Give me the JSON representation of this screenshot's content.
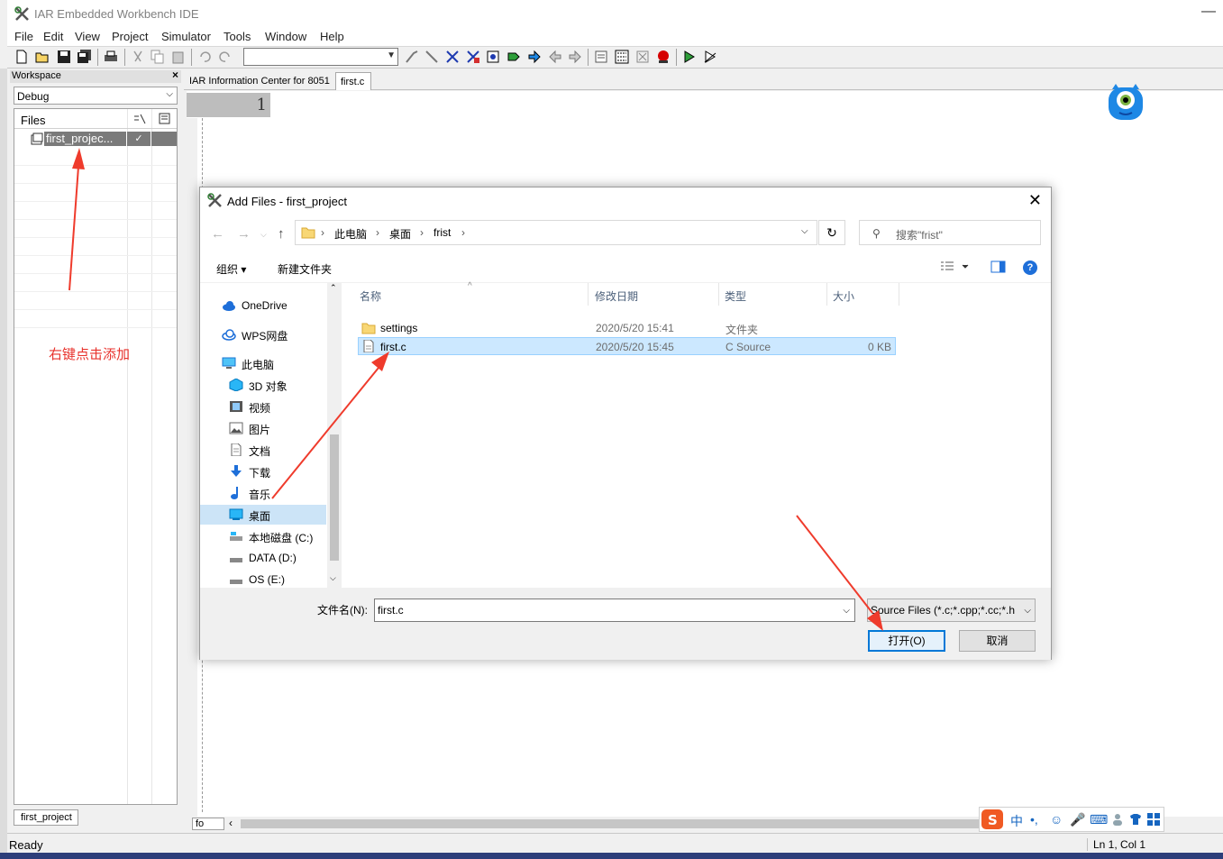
{
  "app": {
    "title": "IAR Embedded Workbench IDE",
    "minimize_glyph": "—"
  },
  "menu": [
    "File",
    "Edit",
    "View",
    "Project",
    "Simulator",
    "Tools",
    "Window",
    "Help"
  ],
  "workspace": {
    "title": "Workspace",
    "close_glyph": "×",
    "config": "Debug",
    "files_header": "Files",
    "project_item": "first_projec...",
    "project_check": "✓",
    "tab": "first_project",
    "annotation": "右键点击添加"
  },
  "editor": {
    "tabs": [
      "IAR Information Center for 8051",
      "first.c"
    ],
    "line_number": "1",
    "bottom_field": "fo",
    "scroll_left": "‹"
  },
  "statusbar": {
    "ready": "Ready",
    "position": "Ln 1, Col 1"
  },
  "ime": [
    "中",
    "•,",
    "☺",
    "🎤",
    "⌨"
  ],
  "dialog": {
    "title": "Add Files - first_project",
    "close_glyph": "✕",
    "breadcrumb": [
      "此电脑",
      "桌面",
      "frist"
    ],
    "search_placeholder": "搜索\"frist\"",
    "organize": "组织 ▾",
    "new_folder": "新建文件夹",
    "help": "?",
    "nav_items": [
      {
        "label": "OneDrive",
        "icon": "cloud-icon"
      },
      {
        "label": "WPS网盘",
        "icon": "cloud-icon"
      },
      {
        "label": "此电脑",
        "icon": "computer-icon"
      },
      {
        "label": "3D 对象",
        "icon": "cube-icon"
      },
      {
        "label": "视频",
        "icon": "video-icon"
      },
      {
        "label": "图片",
        "icon": "picture-icon"
      },
      {
        "label": "文档",
        "icon": "document-icon"
      },
      {
        "label": "下载",
        "icon": "download-icon"
      },
      {
        "label": "音乐",
        "icon": "music-icon"
      },
      {
        "label": "桌面",
        "icon": "desktop-icon"
      },
      {
        "label": "本地磁盘 (C:)",
        "icon": "drive-icon"
      },
      {
        "label": "DATA (D:)",
        "icon": "drive-icon"
      },
      {
        "label": "OS (E:)",
        "icon": "drive-icon"
      }
    ],
    "columns": [
      "名称",
      "修改日期",
      "类型",
      "大小"
    ],
    "files": [
      {
        "name": "settings",
        "date": "2020/5/20 15:41",
        "type": "文件夹",
        "size": ""
      },
      {
        "name": "first.c",
        "date": "2020/5/20 15:45",
        "type": "C Source",
        "size": "0 KB"
      }
    ],
    "filename_label": "文件名(N):",
    "filename_value": "first.c",
    "filetype": "Source Files (*.c;*.cpp;*.cc;*.h",
    "open_button": "打开(O)",
    "cancel_button": "取消"
  },
  "colors": {
    "annotation": "#e8322c",
    "selection": "#cce8ff",
    "accent": "#0078d7"
  }
}
